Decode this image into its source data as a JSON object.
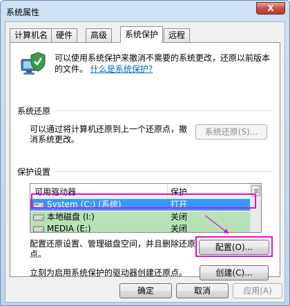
{
  "window": {
    "title": "系统属性",
    "close_glyph": "X"
  },
  "tabs": [
    {
      "label": "计算机名"
    },
    {
      "label": "硬件"
    },
    {
      "label": "高级"
    },
    {
      "label": "系统保护"
    },
    {
      "label": "远程"
    }
  ],
  "active_tab": "系统保护",
  "intro": {
    "text": "可以使用系统保护来撤消不需要的系统更改，还原以前版本的文件。",
    "link": "什么是系统保护?"
  },
  "system_restore": {
    "heading": "系统还原",
    "description": "可以通过将计算机还原到上一个还原点，撤消系统更改。",
    "button": "系统还原(S)..."
  },
  "protection_settings": {
    "heading": "保护设置",
    "columns": [
      "可用驱动器",
      "保护"
    ],
    "rows": [
      {
        "drive": "System (C:) (系统)",
        "protection": "打开",
        "selected": true
      },
      {
        "drive": "本地磁盘 (I:)",
        "protection": "关闭"
      },
      {
        "drive": "MEDIA (E:)",
        "protection": "关闭"
      }
    ],
    "configure_text": "配置还原设置、管理磁盘空间，并且删除还原点。",
    "configure_button": "配置(O)...",
    "create_text": "立刻为启用系统保护的驱动器创建还原点。",
    "create_button": "创建(C)..."
  },
  "footer": {
    "ok": "确定",
    "cancel": "取消",
    "apply": "应用(A)"
  },
  "colors": {
    "highlight": "#e010d0",
    "selected_row": "#3399ff",
    "green_row": "#b7e2b7",
    "link": "#0066cc"
  },
  "icons": {
    "close": "close-icon",
    "hero": "system-protection-icon",
    "drive": "drive-icon",
    "scroll": "scrollbar-thumb"
  }
}
